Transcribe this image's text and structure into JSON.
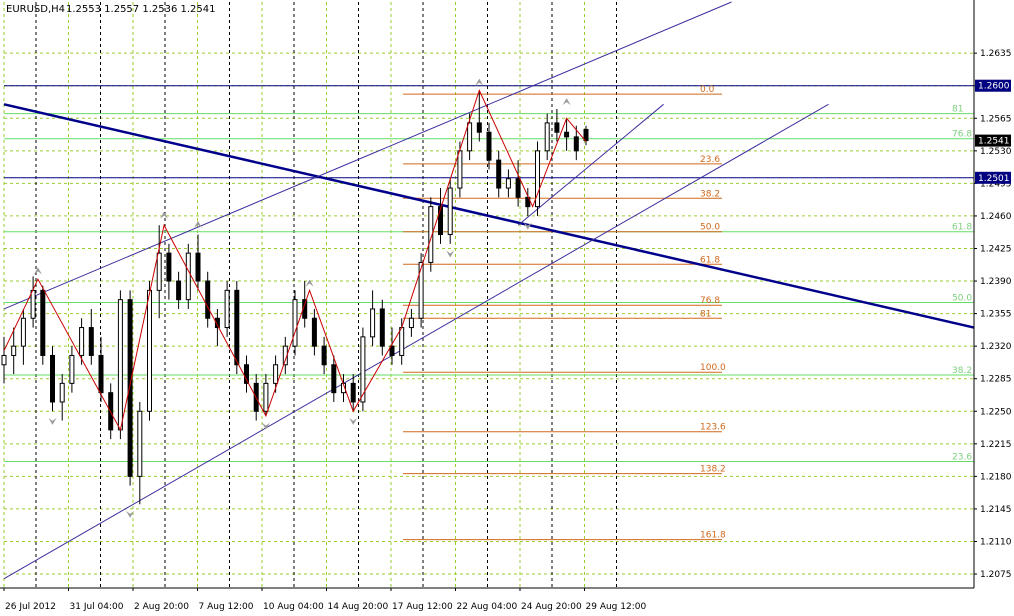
{
  "header": {
    "symbol_tf": "EURUSD,H4",
    "ohlc": "1.2553 1.2557 1.2536 1.2541"
  },
  "colors": {
    "grid": "#9acd32",
    "green_level": "#66dd66",
    "fib": "#d2691e",
    "blue_level": "#000080",
    "trend": "#00008b",
    "channel": "#3c2f9e",
    "zigzag": "#cc0000",
    "candle": "#000000",
    "fractal": "#9a9a9a"
  },
  "chart_data": {
    "type": "candlestick",
    "symbol": "EURUSD",
    "timeframe": "H4",
    "last_ohlc": {
      "open": 1.2553,
      "high": 1.2557,
      "low": 1.2536,
      "close": 1.2541
    },
    "ylim": [
      1.206,
      1.269
    ],
    "y_ticks": [
      "1.2635",
      "1.2600",
      "1.2565",
      "1.2530",
      "1.2495",
      "1.2460",
      "1.2425",
      "1.2390",
      "1.2355",
      "1.2320",
      "1.2285",
      "1.2250",
      "1.2215",
      "1.2180",
      "1.2145",
      "1.2110",
      "1.2075"
    ],
    "x_ticks": [
      "26 Jul 2012",
      "31 Jul 04:00",
      "2 Aug 20:00",
      "7 Aug 12:00",
      "10 Aug 04:00",
      "14 Aug 20:00",
      "17 Aug 12:00",
      "22 Aug 04:00",
      "24 Aug 20:00",
      "29 Aug 12:00"
    ],
    "price_boxes": [
      {
        "label": "1.2600",
        "value": 1.26,
        "style": "box"
      },
      {
        "label": "1.2541",
        "value": 1.2541,
        "style": "current"
      },
      {
        "label": "1.2501",
        "value": 1.2501,
        "style": "box"
      }
    ],
    "fib_levels": [
      {
        "label": "0.0",
        "value": 1.2591
      },
      {
        "label": "23.6",
        "value": 1.2516
      },
      {
        "label": "38.2",
        "value": 1.2479
      },
      {
        "label": "50.0",
        "value": 1.2443
      },
      {
        "label": "61.8",
        "value": 1.2408
      },
      {
        "label": "76.8",
        "value": 1.2364
      },
      {
        "label": "81",
        "value": 1.235
      },
      {
        "label": "100.0",
        "value": 1.2292
      },
      {
        "label": "123.6",
        "value": 1.2228
      },
      {
        "label": "138.2",
        "value": 1.2183
      },
      {
        "label": "161.8",
        "value": 1.2112
      }
    ],
    "green_levels": [
      {
        "label": "81",
        "value": 1.257
      },
      {
        "label": "76.8",
        "value": 1.2543
      },
      {
        "label": "61.8",
        "value": 1.2443
      },
      {
        "label": "50.0",
        "value": 1.2367
      },
      {
        "label": "38.2",
        "value": 1.2289
      },
      {
        "label": "23.6",
        "value": 1.2196
      }
    ],
    "blue_levels": [
      1.26,
      1.2501
    ],
    "series": [
      {
        "kind": "zigzag",
        "points": [
          [
            0.0,
            1.2315
          ],
          [
            0.035,
            1.2392
          ],
          [
            0.12,
            1.223
          ],
          [
            0.165,
            1.245
          ],
          [
            0.27,
            1.2245
          ],
          [
            0.315,
            1.238
          ],
          [
            0.36,
            1.225
          ],
          [
            0.41,
            1.234
          ],
          [
            0.49,
            1.2595
          ],
          [
            0.545,
            1.247
          ],
          [
            0.58,
            1.2565
          ],
          [
            0.6,
            1.254
          ]
        ]
      },
      {
        "kind": "candles",
        "points": [
          [
            0.0,
            1.23,
            1.233,
            1.228,
            1.231
          ],
          [
            0.01,
            1.231,
            1.234,
            1.229,
            1.232
          ],
          [
            0.02,
            1.232,
            1.236,
            1.23,
            1.235
          ],
          [
            0.03,
            1.235,
            1.2395,
            1.234,
            1.238
          ],
          [
            0.04,
            1.238,
            1.2385,
            1.23,
            1.231
          ],
          [
            0.05,
            1.231,
            1.232,
            1.225,
            1.226
          ],
          [
            0.06,
            1.226,
            1.229,
            1.224,
            1.228
          ],
          [
            0.07,
            1.228,
            1.232,
            1.227,
            1.231
          ],
          [
            0.08,
            1.231,
            1.235,
            1.23,
            1.234
          ],
          [
            0.09,
            1.234,
            1.236,
            1.23,
            1.231
          ],
          [
            0.1,
            1.231,
            1.233,
            1.226,
            1.227
          ],
          [
            0.11,
            1.227,
            1.228,
            1.222,
            1.223
          ],
          [
            0.12,
            1.223,
            1.238,
            1.222,
            1.237
          ],
          [
            0.13,
            1.237,
            1.238,
            1.217,
            1.218
          ],
          [
            0.14,
            1.218,
            1.226,
            1.215,
            1.225
          ],
          [
            0.15,
            1.225,
            1.239,
            1.224,
            1.238
          ],
          [
            0.16,
            1.238,
            1.245,
            1.235,
            1.242
          ],
          [
            0.17,
            1.242,
            1.243,
            1.237,
            1.239
          ],
          [
            0.18,
            1.239,
            1.24,
            1.236,
            1.237
          ],
          [
            0.19,
            1.237,
            1.243,
            1.236,
            1.242
          ],
          [
            0.2,
            1.242,
            1.244,
            1.238,
            1.239
          ],
          [
            0.21,
            1.239,
            1.24,
            1.234,
            1.235
          ],
          [
            0.22,
            1.235,
            1.236,
            1.232,
            1.234
          ],
          [
            0.23,
            1.234,
            1.239,
            1.233,
            1.238
          ],
          [
            0.24,
            1.238,
            1.239,
            1.229,
            1.23
          ],
          [
            0.25,
            1.23,
            1.231,
            1.227,
            1.228
          ],
          [
            0.26,
            1.228,
            1.229,
            1.224,
            1.225
          ],
          [
            0.27,
            1.225,
            1.229,
            1.2245,
            1.228
          ],
          [
            0.28,
            1.228,
            1.231,
            1.227,
            1.23
          ],
          [
            0.29,
            1.23,
            1.233,
            1.229,
            1.232
          ],
          [
            0.3,
            1.232,
            1.238,
            1.231,
            1.237
          ],
          [
            0.31,
            1.237,
            1.239,
            1.234,
            1.235
          ],
          [
            0.32,
            1.235,
            1.236,
            1.231,
            1.232
          ],
          [
            0.33,
            1.232,
            1.233,
            1.229,
            1.23
          ],
          [
            0.34,
            1.23,
            1.231,
            1.226,
            1.227
          ],
          [
            0.35,
            1.227,
            1.229,
            1.226,
            1.228
          ],
          [
            0.36,
            1.228,
            1.229,
            1.225,
            1.226
          ],
          [
            0.37,
            1.226,
            1.234,
            1.225,
            1.233
          ],
          [
            0.38,
            1.233,
            1.238,
            1.232,
            1.236
          ],
          [
            0.39,
            1.236,
            1.237,
            1.231,
            1.232
          ],
          [
            0.4,
            1.232,
            1.234,
            1.23,
            1.231
          ],
          [
            0.41,
            1.231,
            1.235,
            1.23,
            1.234
          ],
          [
            0.42,
            1.234,
            1.236,
            1.233,
            1.235
          ],
          [
            0.43,
            1.235,
            1.242,
            1.234,
            1.241
          ],
          [
            0.44,
            1.241,
            1.248,
            1.24,
            1.247
          ],
          [
            0.45,
            1.247,
            1.249,
            1.243,
            1.244
          ],
          [
            0.46,
            1.244,
            1.25,
            1.243,
            1.249
          ],
          [
            0.47,
            1.249,
            1.254,
            1.248,
            1.253
          ],
          [
            0.48,
            1.253,
            1.257,
            1.252,
            1.256
          ],
          [
            0.49,
            1.256,
            1.2595,
            1.254,
            1.255
          ],
          [
            0.5,
            1.255,
            1.256,
            1.251,
            1.252
          ],
          [
            0.51,
            1.252,
            1.253,
            1.248,
            1.249
          ],
          [
            0.52,
            1.249,
            1.251,
            1.248,
            1.25
          ],
          [
            0.53,
            1.25,
            1.252,
            1.247,
            1.248
          ],
          [
            0.54,
            1.248,
            1.249,
            1.246,
            1.247
          ],
          [
            0.55,
            1.247,
            1.254,
            1.246,
            1.253
          ],
          [
            0.56,
            1.253,
            1.257,
            1.252,
            1.256
          ],
          [
            0.57,
            1.256,
            1.2575,
            1.254,
            1.255
          ],
          [
            0.58,
            1.255,
            1.2565,
            1.253,
            1.2545
          ],
          [
            0.59,
            1.2545,
            1.2557,
            1.252,
            1.253
          ],
          [
            0.6,
            1.2553,
            1.2557,
            1.2536,
            1.2541
          ]
        ]
      },
      {
        "kind": "trendline",
        "points": [
          [
            0.0,
            1.258
          ],
          [
            1.0,
            1.234
          ]
        ]
      },
      {
        "kind": "channel_upper",
        "points": [
          [
            0.0,
            1.236
          ],
          [
            0.75,
            1.269
          ]
        ]
      },
      {
        "kind": "channel_lower",
        "points": [
          [
            0.0,
            1.207
          ],
          [
            0.85,
            1.258
          ]
        ]
      },
      {
        "kind": "triangle",
        "points": [
          [
            0.53,
            1.245
          ],
          [
            0.68,
            1.258
          ]
        ]
      },
      {
        "kind": "fractals_up",
        "points": [
          [
            0.035,
            1.2395
          ],
          [
            0.165,
            1.2455
          ],
          [
            0.2,
            1.2445
          ],
          [
            0.315,
            1.2382
          ],
          [
            0.49,
            1.2598
          ],
          [
            0.58,
            1.2577
          ]
        ]
      },
      {
        "kind": "fractals_down",
        "points": [
          [
            0.05,
            1.2245
          ],
          [
            0.13,
            1.2145
          ],
          [
            0.27,
            1.224
          ],
          [
            0.36,
            1.2245
          ],
          [
            0.46,
            1.2425
          ],
          [
            0.54,
            1.2455
          ]
        ]
      }
    ]
  }
}
